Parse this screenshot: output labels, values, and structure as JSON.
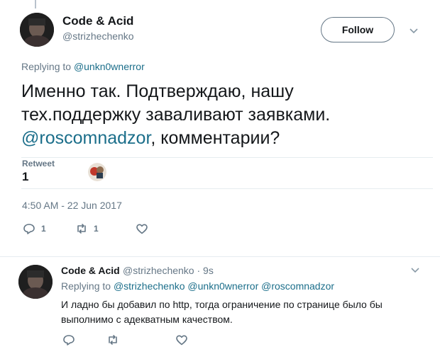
{
  "main_tweet": {
    "display_name": "Code & Acid",
    "handle": "@strizhechenko",
    "follow_label": "Follow",
    "replying_prefix": "Replying to ",
    "replying_to": "@unkn0wnerror",
    "text_line1": "Именно так. Подтверждаю, нашу",
    "text_line2": "тех.поддержку заваливают заявками.",
    "text_mention": "@roscomnadzor",
    "text_line3_rest": ", комментарии?",
    "retweet_label": "Retweet",
    "retweet_count": "1",
    "timestamp": "4:50 AM - 22 Jun 2017",
    "reply_count": "1",
    "retweet_action_count": "1"
  },
  "reply_tweet": {
    "display_name": "Code & Acid",
    "handle_time": "@strizhechenko · 9s",
    "replying_prefix": "Replying to ",
    "replying_to": "@strizhechenko @unkn0wnerror @roscomnadzor",
    "text": "И ладно бы добавил по http, тогда ограничение по странице было бы выполнимо с адекватным качеством."
  },
  "icons": {
    "reply": "reply-icon",
    "retweet": "retweet-icon",
    "like": "heart-icon",
    "menu": "chevron-down-icon"
  },
  "colors": {
    "link": "#1b6e8a",
    "secondary_text": "#657786",
    "primary_text": "#14171a",
    "divider": "#e6ecf0"
  }
}
